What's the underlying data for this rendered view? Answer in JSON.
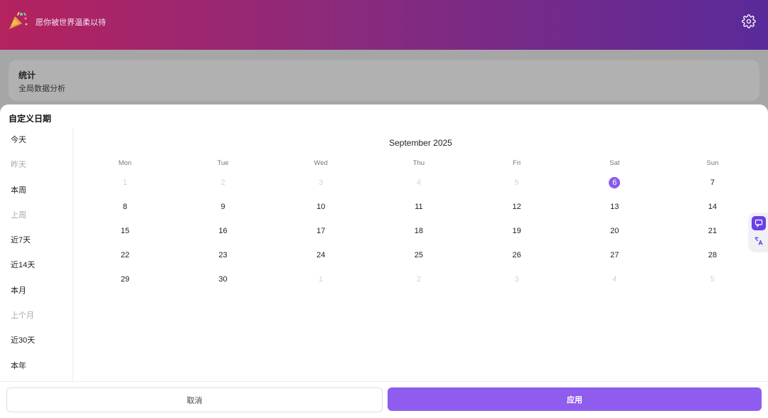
{
  "header": {
    "title": "愿你被世界温柔以待"
  },
  "stats": {
    "title": "统计",
    "subtitle": "全局数据分析"
  },
  "sheet": {
    "title": "自定义日期",
    "quick_ranges": [
      {
        "label": "今天",
        "enabled": true
      },
      {
        "label": "昨天",
        "enabled": false
      },
      {
        "label": "本周",
        "enabled": true
      },
      {
        "label": "上周",
        "enabled": false
      },
      {
        "label": "近7天",
        "enabled": true
      },
      {
        "label": "近14天",
        "enabled": true
      },
      {
        "label": "本月",
        "enabled": true
      },
      {
        "label": "上个月",
        "enabled": false
      },
      {
        "label": "近30天",
        "enabled": true
      },
      {
        "label": "本年",
        "enabled": true
      }
    ],
    "calendar": {
      "month_label": "September 2025",
      "weekdays": [
        "Mon",
        "Tue",
        "Wed",
        "Thu",
        "Fri",
        "Sat",
        "Sun"
      ],
      "weeks": [
        [
          {
            "d": "1",
            "o": true
          },
          {
            "d": "2",
            "o": true
          },
          {
            "d": "3",
            "o": true
          },
          {
            "d": "4",
            "o": true
          },
          {
            "d": "5",
            "o": true
          },
          {
            "d": "6",
            "s": true
          },
          {
            "d": "7"
          }
        ],
        [
          {
            "d": "8"
          },
          {
            "d": "9"
          },
          {
            "d": "10"
          },
          {
            "d": "11"
          },
          {
            "d": "12"
          },
          {
            "d": "13"
          },
          {
            "d": "14"
          }
        ],
        [
          {
            "d": "15"
          },
          {
            "d": "16"
          },
          {
            "d": "17"
          },
          {
            "d": "18"
          },
          {
            "d": "19"
          },
          {
            "d": "20"
          },
          {
            "d": "21"
          }
        ],
        [
          {
            "d": "22"
          },
          {
            "d": "23"
          },
          {
            "d": "24"
          },
          {
            "d": "25"
          },
          {
            "d": "26"
          },
          {
            "d": "27"
          },
          {
            "d": "28"
          }
        ],
        [
          {
            "d": "29"
          },
          {
            "d": "30"
          },
          {
            "d": "1",
            "o": true
          },
          {
            "d": "2",
            "o": true
          },
          {
            "d": "3",
            "o": true
          },
          {
            "d": "4",
            "o": true
          },
          {
            "d": "5",
            "o": true
          }
        ]
      ]
    },
    "cancel_label": "取消",
    "apply_label": "应用"
  },
  "colors": {
    "accent": "#8f5cf0",
    "header_start": "#b5225f",
    "header_end": "#5a2a9a"
  },
  "icons": {
    "logo": "party-popper-icon",
    "settings": "gear-icon",
    "chat": "chat-icon",
    "translate": "translate-icon"
  }
}
